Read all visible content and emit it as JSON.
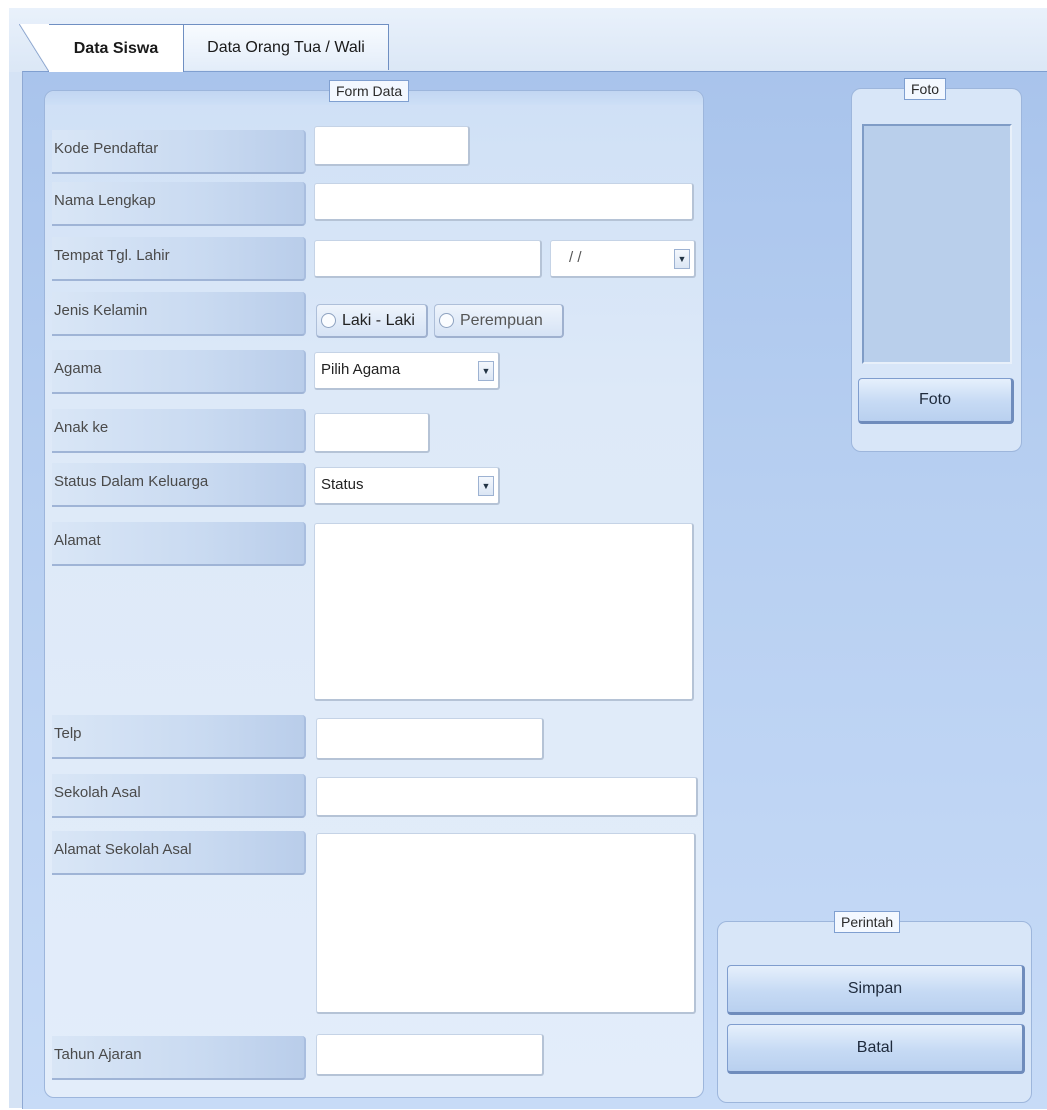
{
  "tabs": [
    {
      "label": "Data Siswa",
      "active": true
    },
    {
      "label": "Data Orang Tua / Wali",
      "active": false
    }
  ],
  "form_group": {
    "title": "Form Data"
  },
  "fields": {
    "kode_pendaftar": {
      "label": "Kode Pendaftar",
      "value": ""
    },
    "nama_lengkap": {
      "label": "Nama Lengkap",
      "value": ""
    },
    "tempat_tgl_lahir": {
      "label": "Tempat Tgl. Lahir",
      "value": "",
      "date_value": "/ /"
    },
    "jenis_kelamin": {
      "label": "Jenis Kelamin",
      "options": [
        "Laki - Laki",
        "Perempuan"
      ],
      "selected": null
    },
    "agama": {
      "label": "Agama",
      "value": "Pilih Agama"
    },
    "anak_ke": {
      "label": "Anak ke",
      "value": ""
    },
    "status_keluarga": {
      "label": "Status Dalam Keluarga",
      "value": "Status"
    },
    "alamat": {
      "label": "Alamat",
      "value": ""
    },
    "telp": {
      "label": "Telp",
      "value": ""
    },
    "sekolah_asal": {
      "label": "Sekolah Asal",
      "value": ""
    },
    "alamat_sekolah_asal": {
      "label": "Alamat Sekolah Asal",
      "value": ""
    },
    "tahun_ajaran": {
      "label": "Tahun Ajaran",
      "value": ""
    }
  },
  "foto_group": {
    "title": "Foto",
    "button_label": "Foto"
  },
  "command_group": {
    "title": "Perintah",
    "save_label": "Simpan",
    "cancel_label": "Batal"
  },
  "colors": {
    "panel": "#b7cff1",
    "button": "#c6daf4",
    "border": "#7f9fd0"
  }
}
